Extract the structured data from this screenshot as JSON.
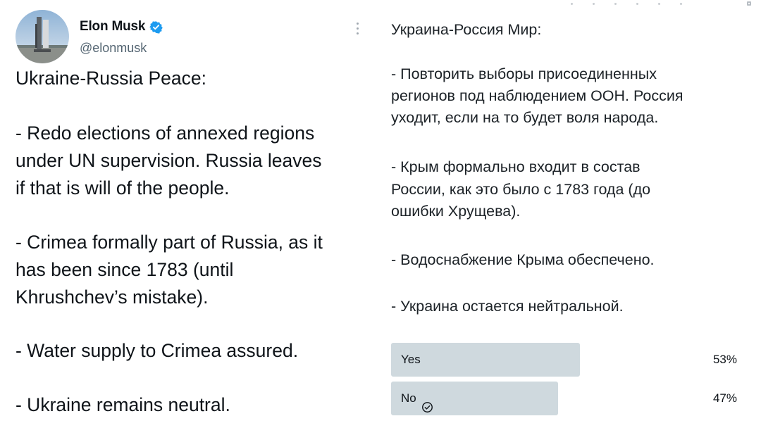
{
  "author": {
    "display_name": "Elon Musk",
    "handle": "@elonmusk",
    "verified": true
  },
  "tweet_en": {
    "title": "Ukraine-Russia Peace:",
    "lines": [
      "- Redo elections of annexed regions",
      "under UN supervision. Russia leaves",
      "if that is will of the people.",
      "- Crimea formally part of Russia, as it",
      "has been since 1783 (until",
      "Khrushchev’s mistake).",
      "- Water supply to Crimea assured.",
      "- Ukraine remains neutral."
    ]
  },
  "tweet_ru": {
    "title": "Украина-Россия Мир:",
    "lines": [
      "- Повторить выборы присоединенных",
      "регионов под наблюдением ООН. Россия",
      "уходит, если на то будет воля народа.",
      "- Крым формально входит в состав",
      "России, как это было с 1783 года (до",
      "ошибки Хрущева).",
      "- Водоснабжение Крыма обеспечено.",
      "- Украина остается нейтральной."
    ]
  },
  "poll": {
    "options": [
      {
        "label": "Yes",
        "percent_text": "53%",
        "fraction": 0.53,
        "selected": false
      },
      {
        "label": "No",
        "percent_text": "47%",
        "fraction": 0.47,
        "selected": true
      }
    ]
  },
  "icons": {
    "verified": "verified-badge-icon",
    "more": "more-options-icon",
    "check": "check-circle-icon"
  },
  "colors": {
    "verified_blue": "#1d9bf0",
    "poll_bar": "#cfd9de",
    "secondary_text": "#536471"
  }
}
